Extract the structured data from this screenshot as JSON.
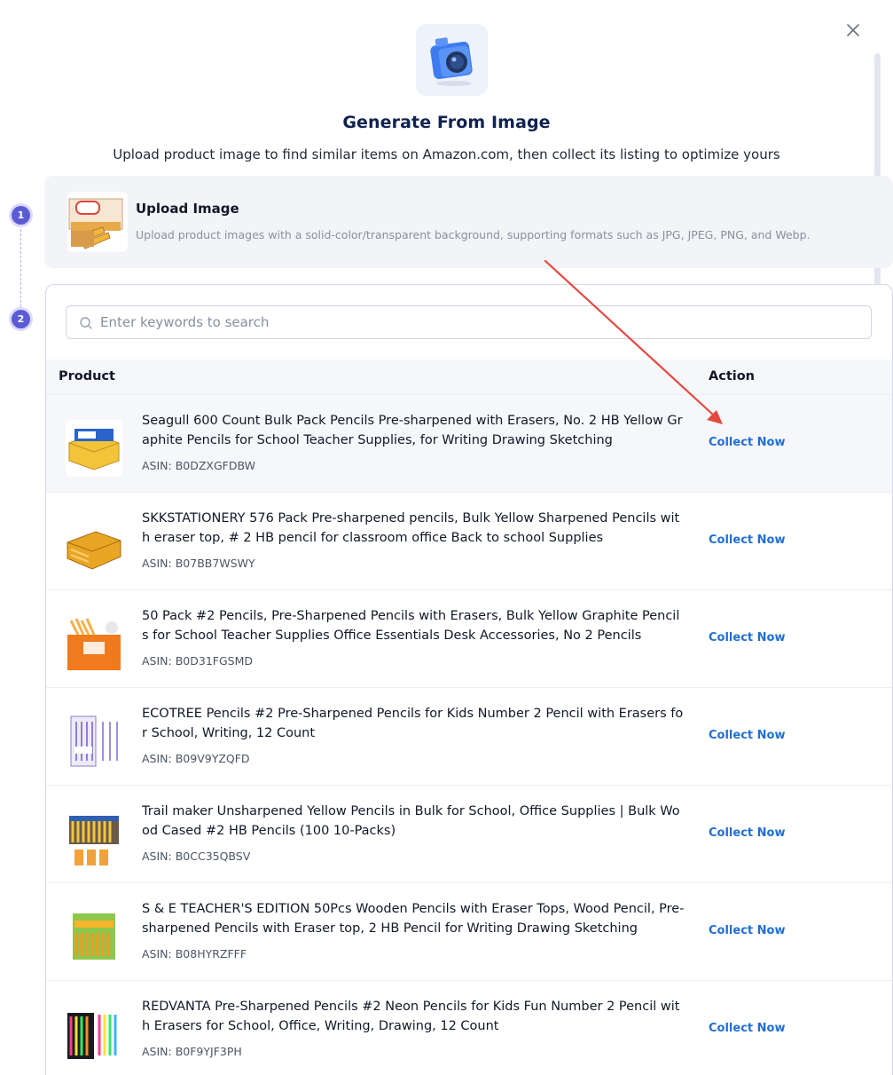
{
  "header": {
    "title": "Generate From Image",
    "subtitle": "Upload product image to find similar items on Amazon.com, then collect its listing to optimize yours"
  },
  "steps": [
    "1",
    "2"
  ],
  "upload": {
    "title": "Upload Image",
    "description": "Upload product images with a solid-color/transparent background, supporting formats such as JPG, JPEG, PNG, and Webp."
  },
  "search": {
    "placeholder": "Enter keywords to search",
    "value": ""
  },
  "table": {
    "headers": {
      "product": "Product",
      "action": "Action"
    },
    "rows": [
      {
        "title": "Seagull 600 Count Bulk Pack Pencils Pre-sharpened with Erasers, No. 2 HB Yellow Graphite Pencils for School Teacher Supplies, for Writing Drawing Sketching",
        "asin": "ASIN: B0DZXGFDBW",
        "action": "Collect Now"
      },
      {
        "title": "SKKSTATIONERY 576 Pack Pre-sharpened pencils, Bulk Yellow Sharpened Pencils with eraser top, # 2 HB pencil for classroom office Back to school Supplies",
        "asin": "ASIN: B07BB7WSWY",
        "action": "Collect Now"
      },
      {
        "title": "50 Pack #2 Pencils, Pre-Sharpened Pencils with Erasers, Bulk Yellow Graphite Pencils for School Teacher Supplies Office Essentials Desk Accessories, No 2 Pencils",
        "asin": "ASIN: B0D31FGSMD",
        "action": "Collect Now"
      },
      {
        "title": "ECOTREE Pencils #2 Pre-Sharpened Pencils for Kids Number 2 Pencil with Erasers for School, Writing, 12 Count",
        "asin": "ASIN: B09V9YZQFD",
        "action": "Collect Now"
      },
      {
        "title": "Trail maker Unsharpened Yellow Pencils in Bulk for School, Office Supplies | Bulk Wood Cased #2 HB Pencils (100 10-Packs)",
        "asin": "ASIN: B0CC35QBSV",
        "action": "Collect Now"
      },
      {
        "title": "S & E TEACHER'S EDITION 50Pcs Wooden Pencils with Eraser Tops, Wood Pencil, Pre-sharpened Pencils with Eraser top, 2 HB Pencil for Writing Drawing Sketching",
        "asin": "ASIN: B08HYRZFFF",
        "action": "Collect Now"
      },
      {
        "title": "REDVANTA Pre-Sharpened Pencils #2 Neon Pencils for Kids Fun Number 2 Pencil with Erasers for School, Office, Writing, Drawing, 12 Count",
        "asin": "ASIN: B0F9YJF3PH",
        "action": "Collect Now"
      }
    ]
  },
  "colors": {
    "title": "#0f2250",
    "accent": "#1f6fd6",
    "step": "#5b5bd6",
    "annotation_arrow": "#e5483f"
  },
  "icons": {
    "close": "close-icon",
    "hero": "camera-icon",
    "search": "search-icon"
  }
}
